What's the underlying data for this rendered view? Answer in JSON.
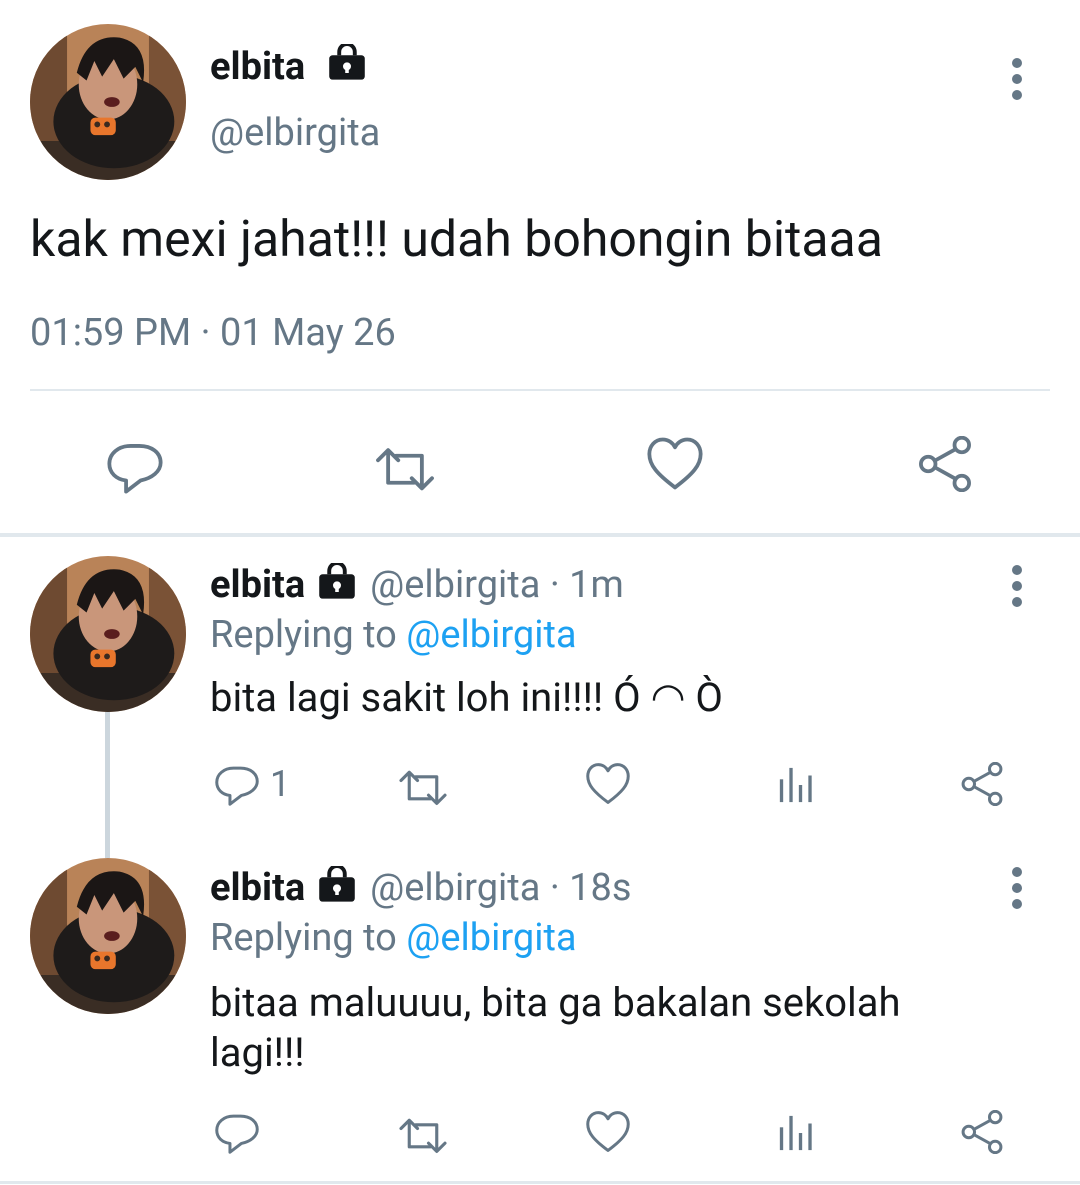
{
  "main_tweet": {
    "display_name": "elbita",
    "handle": "@elbirgita",
    "text": "kak mexi jahat!!! udah bohongin bitaaa",
    "timestamp": "01:59 PM · 01 May 26",
    "actions": [
      "reply-icon",
      "retweet-icon",
      "like-icon",
      "share-icon"
    ]
  },
  "replies": [
    {
      "display_name": "elbita",
      "handle": "@elbirgita",
      "time": " · 1m",
      "replying_prefix": "Replying to ",
      "replying_to": "@elbirgita",
      "text": "bita lagi sakit loh ini!!!! Ó ◠ Ò",
      "reply_count": "1",
      "actions": [
        "reply-icon",
        "retweet-icon",
        "like-icon",
        "analytics-icon",
        "share-icon"
      ]
    },
    {
      "display_name": "elbita",
      "handle": "@elbirgita",
      "time": " · 18s",
      "replying_prefix": "Replying to ",
      "replying_to": "@elbirgita",
      "text": "bitaa maluuuu, bita ga bakalan sekolah lagi!!!",
      "reply_count": "",
      "actions": [
        "reply-icon",
        "retweet-icon",
        "like-icon",
        "analytics-icon",
        "share-icon"
      ]
    }
  ],
  "colors": {
    "text": "#14171a",
    "secondary": "#657786",
    "link": "#1da1f2",
    "divider": "#e1e8ed"
  }
}
